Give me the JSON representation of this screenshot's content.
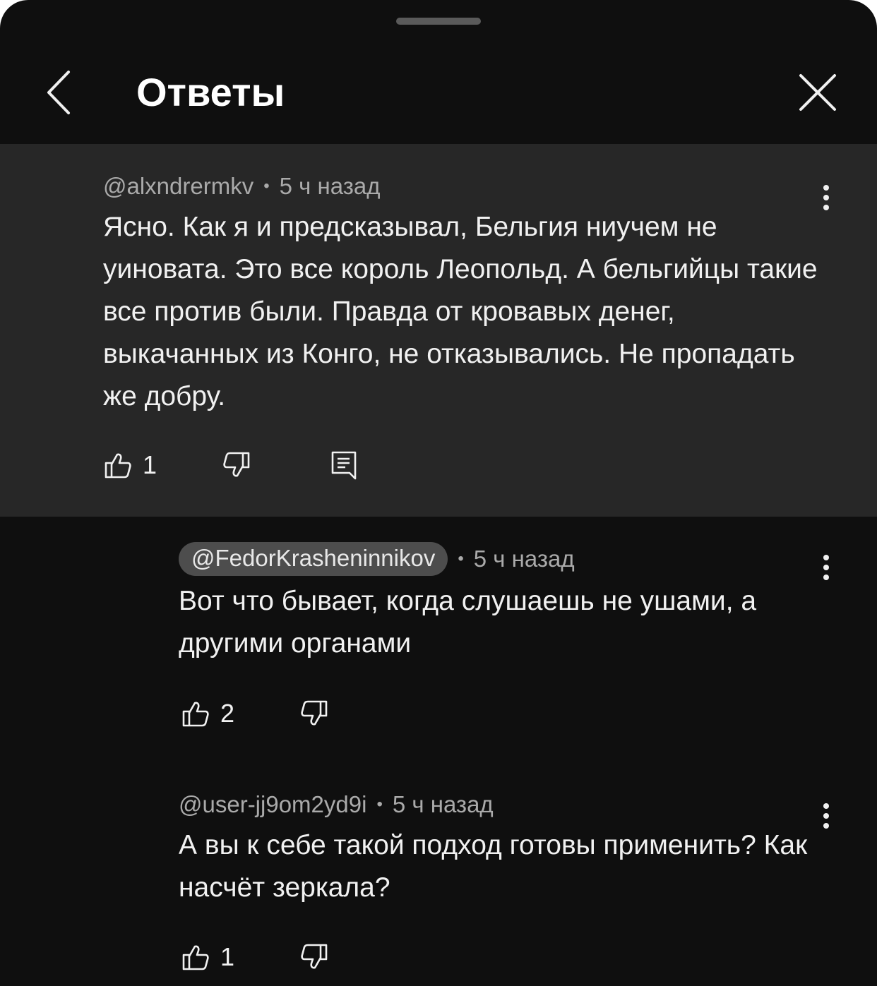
{
  "header": {
    "title": "Ответы"
  },
  "icons": {
    "back": "chevron-left-icon",
    "close": "close-icon",
    "like": "thumb-up-icon",
    "dislike": "thumb-down-icon",
    "reply": "reply-icon",
    "more": "more-vert-icon"
  },
  "colors": {
    "sheet_bg": "#0f0f0f",
    "highlight_bg": "#272727",
    "text_primary": "#f1f1f1",
    "text_secondary": "#aaaaaa",
    "pill_bg": "#4d4d4d"
  },
  "comments": [
    {
      "author": "@alxndrermkv",
      "time": "5 ч назад",
      "text": "Ясно. Как я и предсказывал, Бельгия ниучем не уиновата. Это все король Леопольд. А бельгийцы такие все против были. Правда от кровавых денег, выкачанных из Конго, не отказывались. Не пропадать же добру.",
      "likes": "1",
      "highlighted": true
    },
    {
      "author": "@FedorKrasheninnikov",
      "time": "5 ч назад",
      "text": "Вот что бывает, когда слушаешь не ушами, а другими органами",
      "likes": "2",
      "author_is_creator_pill": true
    },
    {
      "author": "@user-jj9om2yd9i",
      "time": "5 ч назад",
      "text": "А вы к себе такой подход готовы применить? Как насчёт зеркала?",
      "likes": "1"
    }
  ]
}
